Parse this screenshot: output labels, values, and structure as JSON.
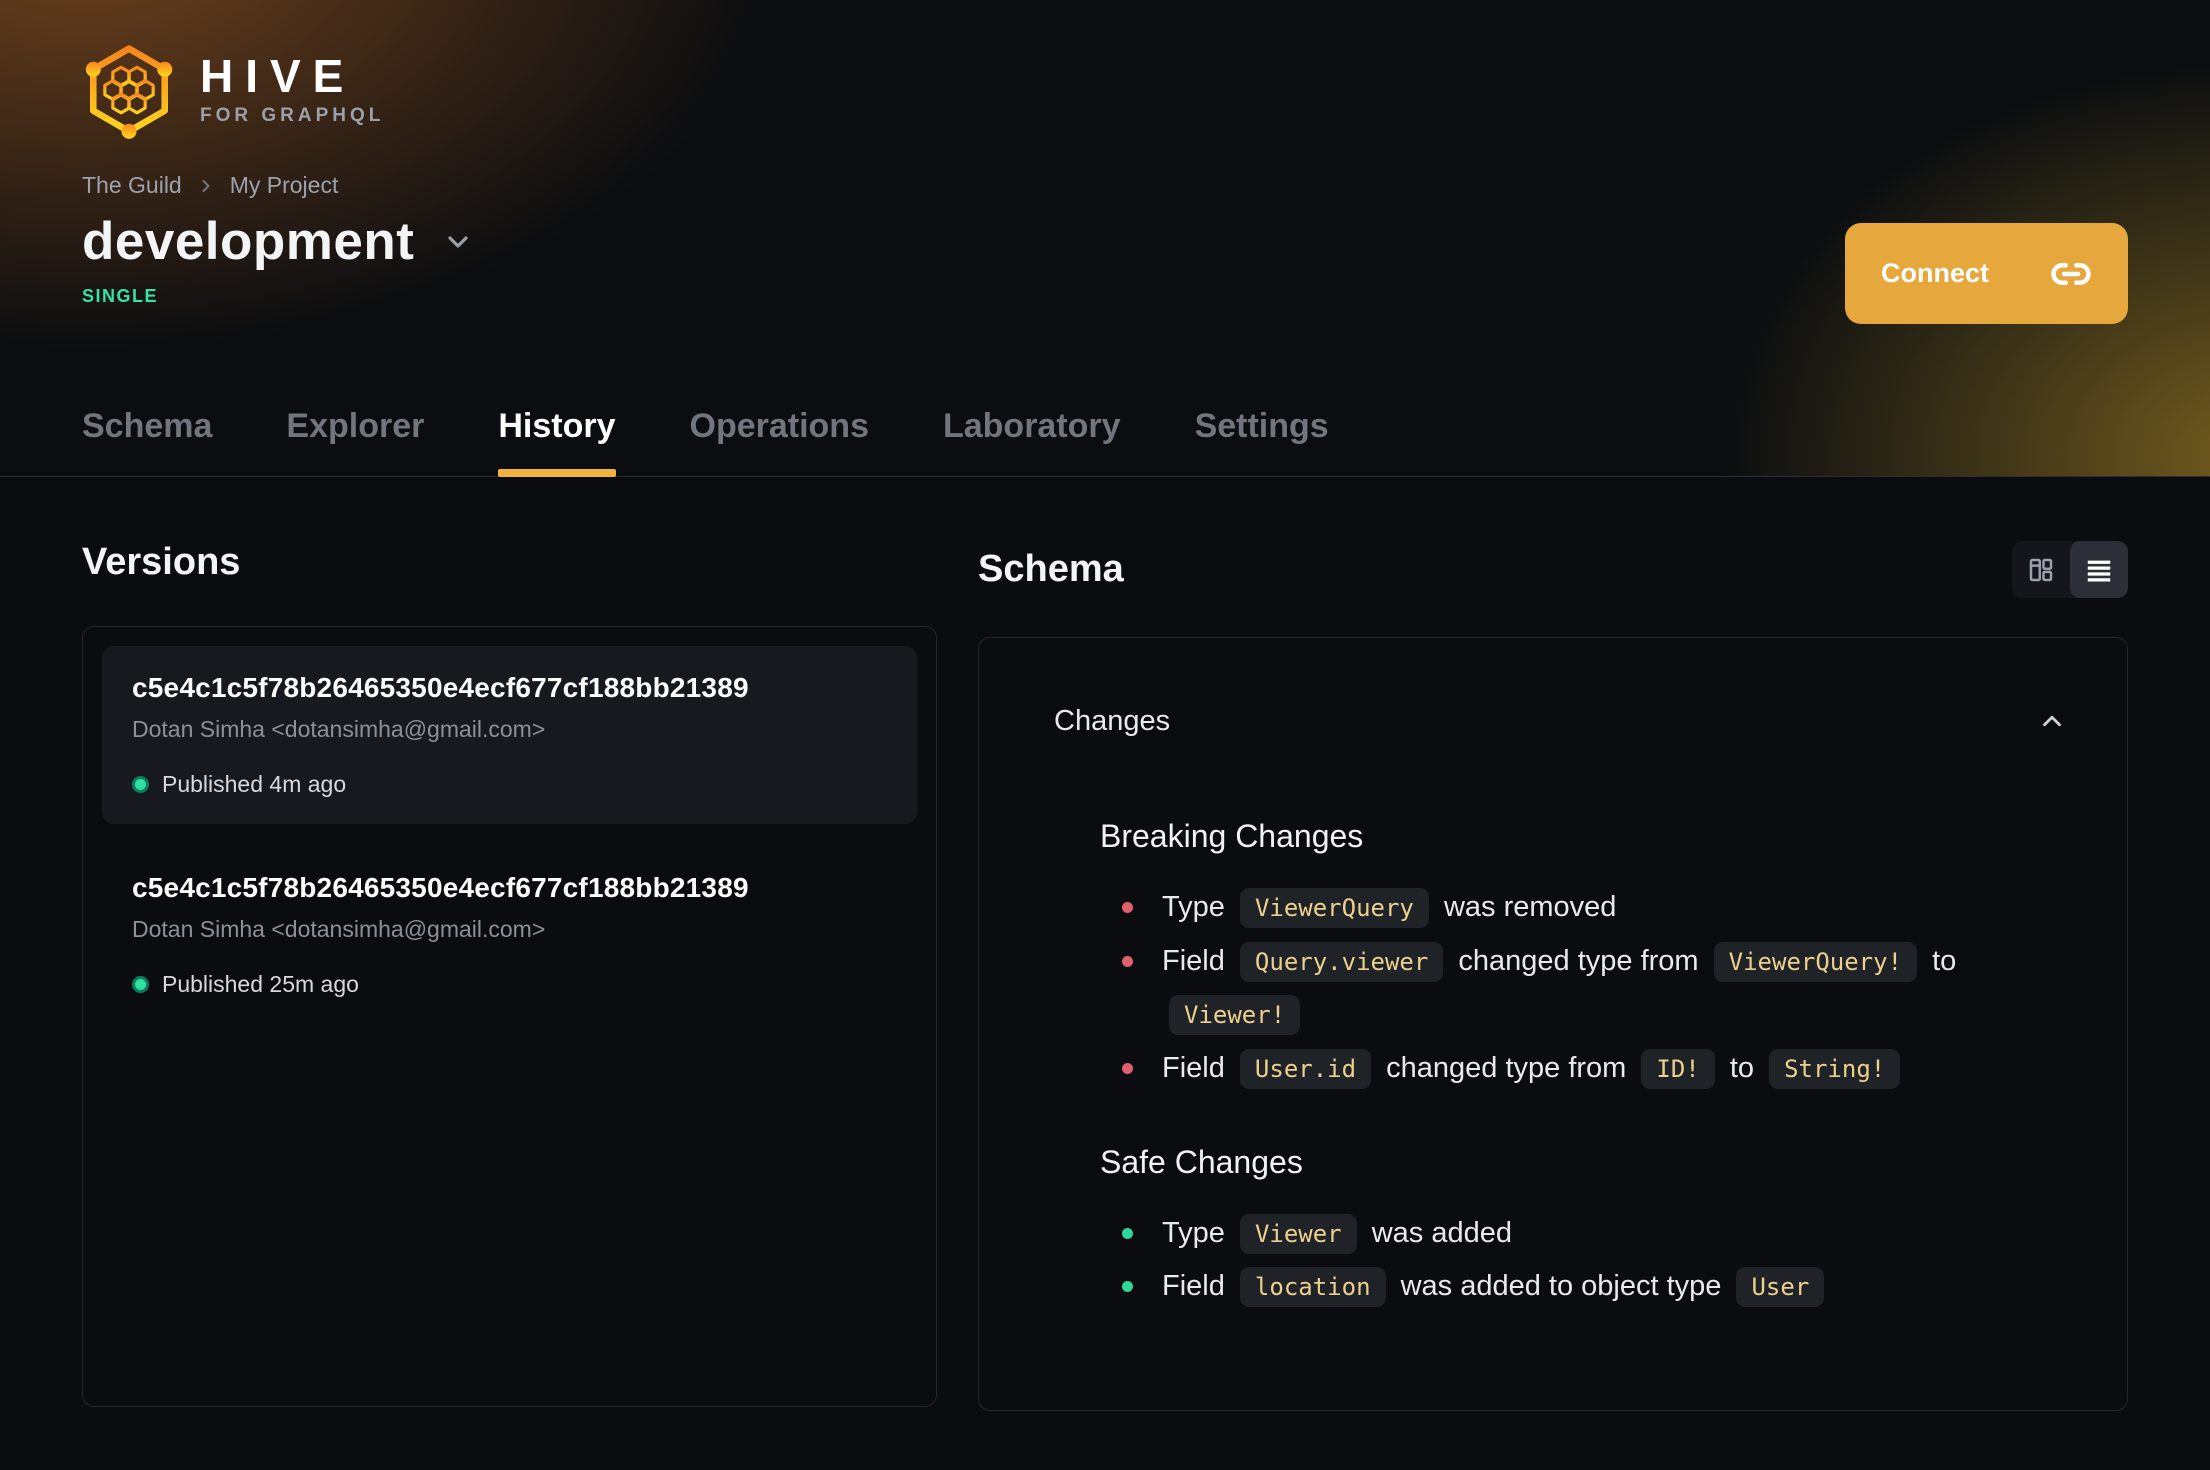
{
  "brand": {
    "name": "HIVE",
    "tagline": "FOR GRAPHQL"
  },
  "breadcrumb": {
    "org": "The Guild",
    "project": "My Project"
  },
  "target": {
    "name": "development",
    "badge": "SINGLE"
  },
  "connect": {
    "label": "Connect",
    "icon": "link-icon"
  },
  "tabs": [
    {
      "label": "Schema",
      "active": false
    },
    {
      "label": "Explorer",
      "active": false
    },
    {
      "label": "History",
      "active": true
    },
    {
      "label": "Operations",
      "active": false
    },
    {
      "label": "Laboratory",
      "active": false
    },
    {
      "label": "Settings",
      "active": false
    }
  ],
  "versions": {
    "title": "Versions",
    "items": [
      {
        "hash": "c5e4c1c5f78b26465350e4ecf677cf188bb21389",
        "author": "Dotan Simha <dotansimha@gmail.com>",
        "status": "Published 4m ago",
        "selected": true
      },
      {
        "hash": "c5e4c1c5f78b26465350e4ecf677cf188bb21389",
        "author": "Dotan Simha <dotansimha@gmail.com>",
        "status": "Published 25m ago",
        "selected": false
      }
    ]
  },
  "schema_panel": {
    "title": "Schema",
    "view_modes": [
      "columns-view-icon",
      "list-view-icon"
    ],
    "active_view": "list-view-icon",
    "changes_title": "Changes",
    "sections": [
      {
        "kind": "breaking",
        "title": "Breaking Changes",
        "items": [
          [
            {
              "text": "Type"
            },
            {
              "code": "ViewerQuery"
            },
            {
              "text": "was removed"
            }
          ],
          [
            {
              "text": "Field"
            },
            {
              "code": "Query.viewer"
            },
            {
              "text": "changed type from"
            },
            {
              "code": "ViewerQuery!"
            },
            {
              "text": "to"
            },
            {
              "code": "Viewer!"
            }
          ],
          [
            {
              "text": "Field"
            },
            {
              "code": "User.id"
            },
            {
              "text": "changed type from"
            },
            {
              "code": "ID!"
            },
            {
              "text": "to"
            },
            {
              "code": "String!"
            }
          ]
        ]
      },
      {
        "kind": "safe",
        "title": "Safe Changes",
        "items": [
          [
            {
              "text": "Type"
            },
            {
              "code": "Viewer"
            },
            {
              "text": "was added"
            }
          ],
          [
            {
              "text": "Field"
            },
            {
              "code": "location"
            },
            {
              "text": "was added to object type"
            },
            {
              "code": "User"
            }
          ]
        ]
      }
    ]
  },
  "colors": {
    "accent": "#f0b13d",
    "connect": "#e6a83d",
    "badge": "#35e3a8",
    "breaking": "#e0606e",
    "safe": "#2fd79c",
    "chip-text": "#ecd08e"
  }
}
